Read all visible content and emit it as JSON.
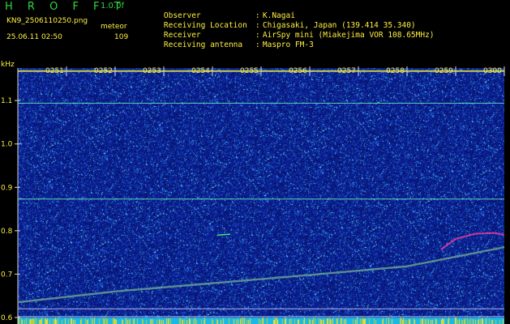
{
  "app": {
    "title": "H R O F F T",
    "version": "1.0.0f",
    "filename": "KN9_2506110250.png",
    "timestamp": "25.06.11 02:50",
    "counter_label": "meteor",
    "counter_value": "109"
  },
  "metadata": [
    {
      "label": "Observer",
      "value": "K.Nagai"
    },
    {
      "label": "Receiving Location",
      "value": "Chigasaki, Japan (139.414 35.340)"
    },
    {
      "label": "Receiver",
      "value": "AirSpy mini (Miakejima VOR 108.65MHz)"
    },
    {
      "label": "Receiving antenna",
      "value": "Maspro FM-3"
    }
  ],
  "chart_data": {
    "type": "heatmap",
    "y_unit": "kHz",
    "y_ticks": [
      "1.1",
      "1.0",
      "0.9",
      "0.8",
      "0.7",
      "0.6"
    ],
    "y_range": [
      0.585,
      1.175
    ],
    "time_ticks": [
      "0251",
      "0252",
      "0253",
      "0254",
      "0255",
      "0256",
      "0257",
      "0258",
      "0259",
      "0300"
    ],
    "time_range": [
      "0250",
      "0300"
    ],
    "horizontal_lines_khz": [
      1.168,
      1.094,
      0.873,
      0.62,
      0.602
    ],
    "traces": [
      {
        "x_minutes": [
          0,
          2,
          4,
          6,
          8,
          10
        ],
        "y_khz": [
          0.635,
          0.66,
          0.679,
          0.698,
          0.718,
          0.762
        ]
      },
      {
        "x_minutes": [
          8.7,
          9.0,
          9.4,
          9.8,
          10
        ],
        "y_khz": [
          0.757,
          0.781,
          0.793,
          0.795,
          0.79
        ]
      }
    ],
    "colors": {
      "background": "#000000",
      "noise_base": "#0a1e8c",
      "label": "#ffef40",
      "tick": "#d8d8d8",
      "trace": "#d03cff"
    }
  }
}
